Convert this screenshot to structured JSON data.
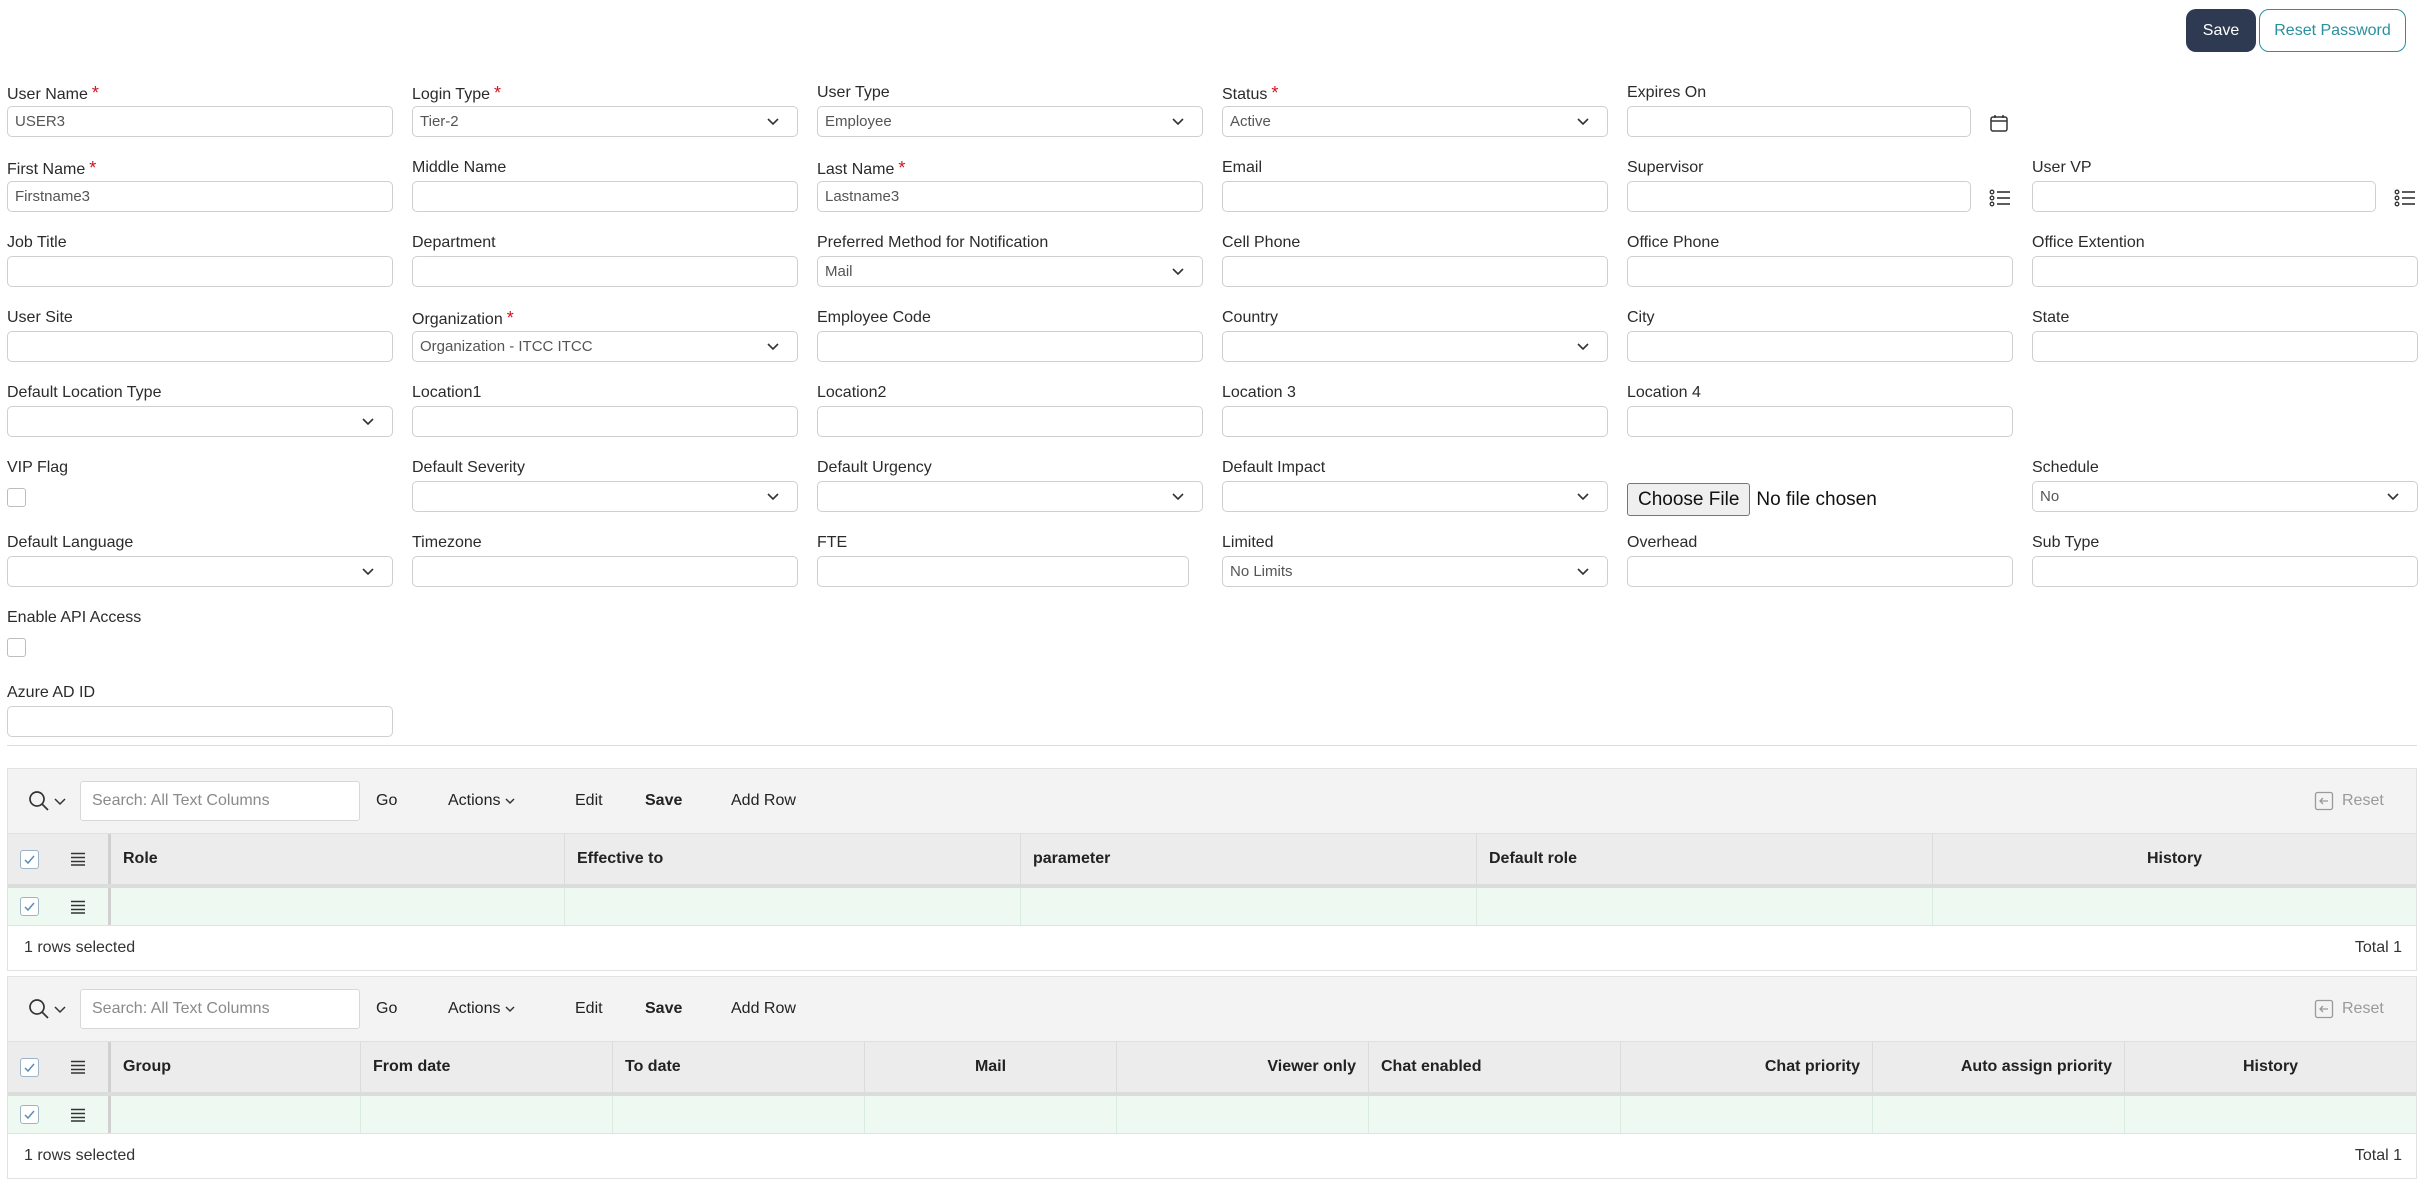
{
  "header": {
    "save_label": "Save",
    "reset_password_label": "Reset Password"
  },
  "form": {
    "user_name": {
      "label": "User Name",
      "required": "*",
      "value": "USER3"
    },
    "login_type": {
      "label": "Login Type",
      "required": "*",
      "value": "Tier-2"
    },
    "user_type": {
      "label": "User Type",
      "value": "Employee"
    },
    "status": {
      "label": "Status",
      "required": "*",
      "value": "Active"
    },
    "expires_on": {
      "label": "Expires On",
      "value": ""
    },
    "first_name": {
      "label": "First Name",
      "required": "*",
      "value": "Firstname3"
    },
    "middle_name": {
      "label": "Middle Name",
      "value": ""
    },
    "last_name": {
      "label": "Last Name",
      "required": "*",
      "value": "Lastname3"
    },
    "email": {
      "label": "Email",
      "value": ""
    },
    "supervisor": {
      "label": "Supervisor",
      "value": ""
    },
    "user_vp": {
      "label": "User VP",
      "value": ""
    },
    "job_title": {
      "label": "Job Title",
      "value": ""
    },
    "department": {
      "label": "Department",
      "value": ""
    },
    "preferred_notification": {
      "label": "Preferred Method for Notification",
      "value": "Mail"
    },
    "cell_phone": {
      "label": "Cell Phone",
      "value": ""
    },
    "office_phone": {
      "label": "Office Phone",
      "value": ""
    },
    "office_extension": {
      "label": "Office Extention",
      "value": ""
    },
    "user_site": {
      "label": "User Site",
      "value": ""
    },
    "organization": {
      "label": "Organization",
      "required": "*",
      "value": "Organization - ITCC ITCC"
    },
    "employee_code": {
      "label": "Employee Code",
      "value": ""
    },
    "country": {
      "label": "Country",
      "value": ""
    },
    "city": {
      "label": "City",
      "value": ""
    },
    "state": {
      "label": "State",
      "value": ""
    },
    "default_location_type": {
      "label": "Default Location Type",
      "value": ""
    },
    "location1": {
      "label": "Location1",
      "value": ""
    },
    "location2": {
      "label": "Location2",
      "value": ""
    },
    "location3": {
      "label": "Location 3",
      "value": ""
    },
    "location4": {
      "label": "Location 4",
      "value": ""
    },
    "vip_flag": {
      "label": "VIP Flag"
    },
    "default_severity": {
      "label": "Default Severity",
      "value": ""
    },
    "default_urgency": {
      "label": "Default Urgency",
      "value": ""
    },
    "default_impact": {
      "label": "Default Impact",
      "value": ""
    },
    "file_upload": {
      "button_label": "Choose File",
      "status_text": "No file chosen"
    },
    "schedule": {
      "label": "Schedule",
      "value": "No"
    },
    "default_language": {
      "label": "Default Language",
      "value": ""
    },
    "timezone": {
      "label": "Timezone",
      "value": ""
    },
    "fte": {
      "label": "FTE",
      "value": ""
    },
    "limited": {
      "label": "Limited",
      "value": "No Limits"
    },
    "overhead": {
      "label": "Overhead",
      "value": ""
    },
    "sub_type": {
      "label": "Sub Type",
      "value": ""
    },
    "enable_api_access": {
      "label": "Enable API Access"
    },
    "azure_ad_id": {
      "label": "Azure AD ID",
      "value": ""
    }
  },
  "roles_grid": {
    "toolbar": {
      "search_placeholder": "Search: All Text Columns",
      "go_label": "Go",
      "actions_label": "Actions",
      "edit_label": "Edit",
      "save_label": "Save",
      "add_row_label": "Add Row",
      "reset_label": "Reset"
    },
    "columns": [
      "Role",
      "Effective to",
      "parameter",
      "Default role",
      "History"
    ],
    "footer": {
      "selected_text": "1 rows selected",
      "total_text": "Total 1"
    }
  },
  "groups_grid": {
    "toolbar": {
      "search_placeholder": "Search: All Text Columns",
      "go_label": "Go",
      "actions_label": "Actions",
      "edit_label": "Edit",
      "save_label": "Save",
      "add_row_label": "Add Row",
      "reset_label": "Reset"
    },
    "columns": [
      "Group",
      "From date",
      "To date",
      "Mail",
      "Viewer only",
      "Chat enabled",
      "Chat priority",
      "Auto assign priority",
      "History"
    ],
    "footer": {
      "selected_text": "1 rows selected",
      "total_text": "Total 1"
    }
  },
  "icons": {
    "calendar": "calendar-icon",
    "list_picker": "list-picker-icon",
    "chevron": "chevron-down-icon",
    "search": "search-icon",
    "row_menu": "row-menu-icon",
    "reset": "reset-icon"
  }
}
